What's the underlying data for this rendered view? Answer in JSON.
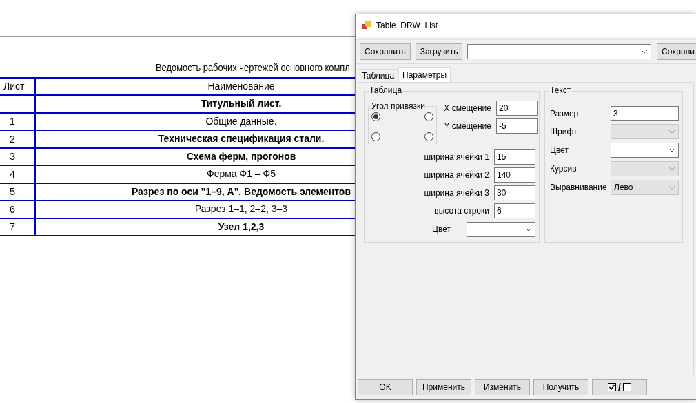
{
  "drawing": {
    "title": "Ведомость рабочих чертежей основного компл",
    "columns": [
      "Лист",
      "Наименование"
    ],
    "rows": [
      {
        "sheet": "",
        "name": "Титульный лист.",
        "bold": true
      },
      {
        "sheet": "1",
        "name": "Общие данные.",
        "bold": false
      },
      {
        "sheet": "2",
        "name": "Техническая спецификация стали.",
        "bold": true
      },
      {
        "sheet": "3",
        "name": "Схема ферм, прогонов",
        "bold": true
      },
      {
        "sheet": "4",
        "name": "Ферма Ф1 – Ф5",
        "bold": false
      },
      {
        "sheet": "5",
        "name": "Разрез по оси \"1–9, А\". Ведомость элементов",
        "bold": true
      },
      {
        "sheet": "6",
        "name": "Разрез 1–1, 2–2, 3–3",
        "bold": false
      },
      {
        "sheet": "7",
        "name": "Узел 1,2,3",
        "bold": true
      }
    ]
  },
  "window": {
    "title": "Table_DRW_List",
    "toolbar": {
      "save": "Сохранить",
      "load": "Загрузить",
      "save_cut": "Сохрани"
    },
    "tabs": [
      {
        "label": "Таблица",
        "selected": false
      },
      {
        "label": "Параметры",
        "selected": true
      }
    ],
    "table_group": {
      "title": "Таблица",
      "anchor_title": "Угол привязки",
      "anchors": [
        {
          "selected": true
        },
        {
          "selected": false
        },
        {
          "selected": false
        },
        {
          "selected": false
        }
      ],
      "offsets": [
        {
          "label": "X смещение",
          "value": "20"
        },
        {
          "label": "Y смещение",
          "value": "-5"
        }
      ],
      "fields": [
        {
          "label": "ширина ячейки 1",
          "value": "15"
        },
        {
          "label": "ширина ячейки 2",
          "value": "140"
        },
        {
          "label": "ширина ячейки 3",
          "value": "30"
        },
        {
          "label": "высота строки",
          "value": "6"
        }
      ],
      "color_label": "Цвет"
    },
    "text_group": {
      "title": "Текст",
      "fields": [
        {
          "kind": "input",
          "label": "Размер",
          "value": "3"
        },
        {
          "kind": "combo",
          "label": "Шрифт",
          "disabled": true
        },
        {
          "kind": "combo",
          "label": "Цвет",
          "disabled": false
        },
        {
          "kind": "combo",
          "label": "Курсив",
          "disabled": true
        },
        {
          "kind": "combo",
          "label": "Выравнивание",
          "value": "Лево",
          "disabled": true
        }
      ]
    },
    "buttons": [
      "OK",
      "Применить",
      "Изменить",
      "Получить"
    ],
    "toggle_separator": "/"
  }
}
